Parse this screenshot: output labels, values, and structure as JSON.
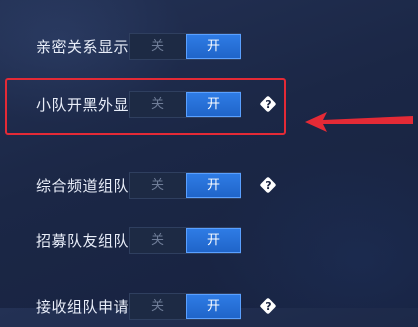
{
  "settings": [
    {
      "label": "亲密关系显示",
      "off": "关",
      "on": "开",
      "help": ""
    },
    {
      "label": "小队开黑外显",
      "off": "关",
      "on": "开",
      "help": "?"
    },
    {
      "label": "综合频道组队",
      "off": "关",
      "on": "开",
      "help": "?"
    },
    {
      "label": "招募队友组队",
      "off": "关",
      "on": "开",
      "help": ""
    },
    {
      "label": "接收组队申请",
      "off": "关",
      "on": "开",
      "help": "?"
    }
  ],
  "highlight": {
    "color": "#e42a36",
    "target": "小队开黑外显"
  },
  "colors": {
    "accent": "#2f7de6",
    "background": "#1b2746"
  }
}
